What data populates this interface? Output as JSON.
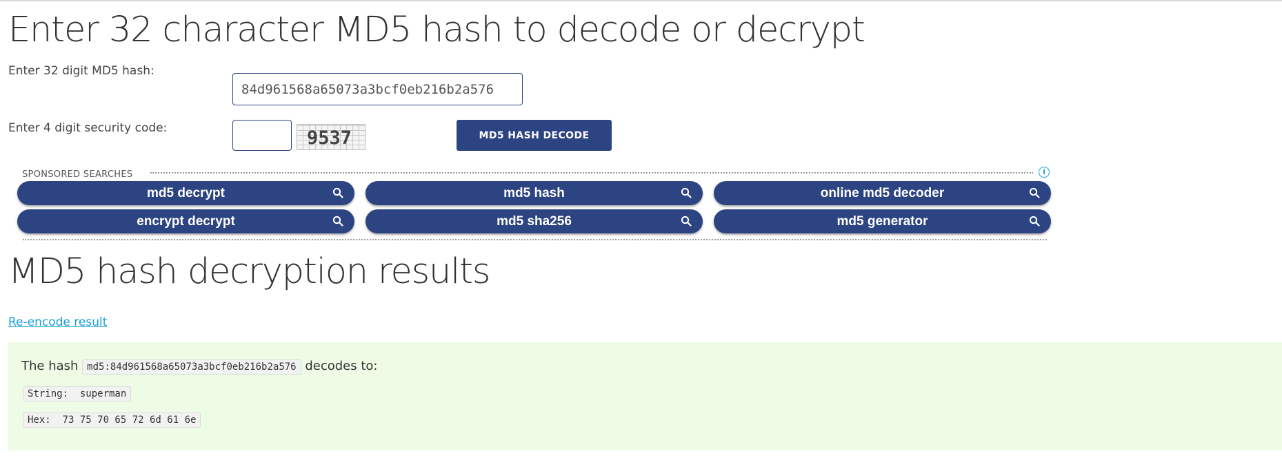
{
  "header": {
    "title": "Enter 32 character MD5 hash to decode or decrypt"
  },
  "form": {
    "hash_label": "Enter 32 digit MD5 hash:",
    "hash_value": "84d961568a65073a3bcf0eb216b2a576",
    "code_label": "Enter 4 digit security code:",
    "code_value": "",
    "captcha_text": "9537",
    "decode_button": "MD5 HASH DECODE"
  },
  "sponsored": {
    "label": "SPONSORED SEARCHES",
    "info_icon": "info-icon",
    "items": [
      {
        "label": "md5 decrypt"
      },
      {
        "label": "md5 hash"
      },
      {
        "label": "online md5 decoder"
      },
      {
        "label": "encrypt decrypt"
      },
      {
        "label": "md5 sha256"
      },
      {
        "label": "md5 generator"
      }
    ]
  },
  "results": {
    "title": "MD5 hash decryption results",
    "reencode_link": "Re-encode result",
    "prefix": "The hash",
    "hash_code": "md5:84d961568a65073a3bcf0eb216b2a576",
    "suffix": "decodes to:",
    "string_line": "String:  superman",
    "hex_line": "Hex:  73 75 70 65 72 6d 61 6e"
  },
  "colors": {
    "accent": "#2d4482",
    "link": "#1a9fd6",
    "result_bg": "#eefce6"
  }
}
